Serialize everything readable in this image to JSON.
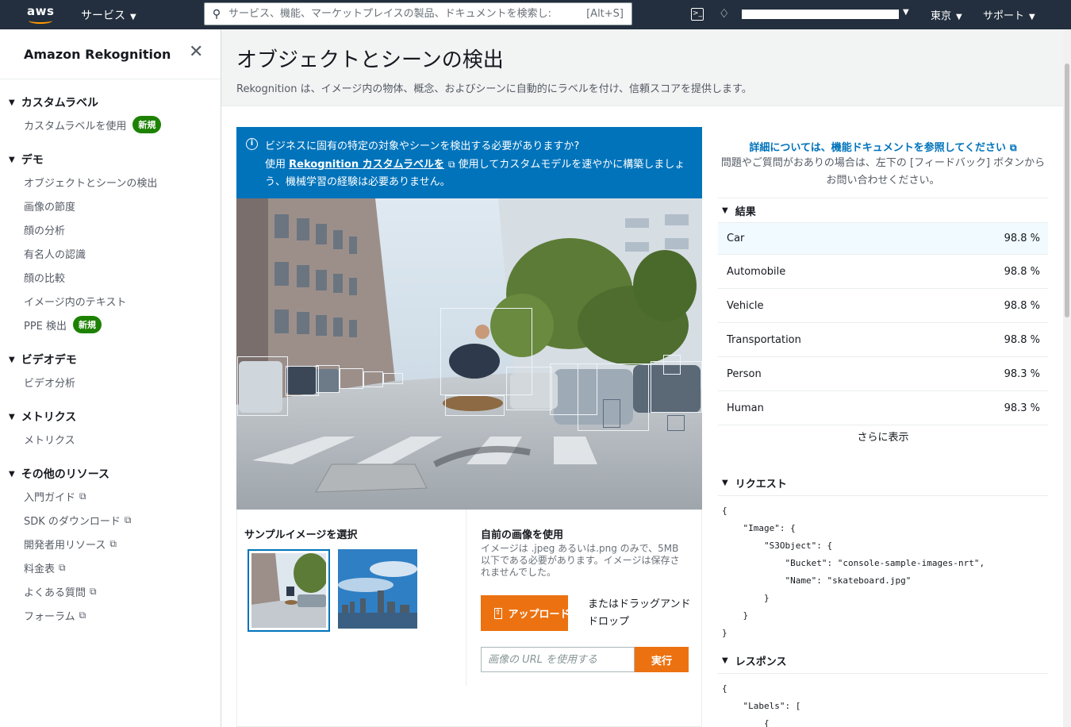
{
  "nav": {
    "logo_text": "aws",
    "services_label": "サービス",
    "search_placeholder": "サービス、機能、マーケットプレイスの製品、ドキュメントを検索し:",
    "search_shortcut": "[Alt+S]",
    "region_label": "東京",
    "support_label": "サポート"
  },
  "sidebar": {
    "title": "Amazon Rekognition",
    "sections": [
      {
        "title": "カスタムラベル",
        "items": [
          {
            "label": "カスタムラベルを使用",
            "badge": "新規"
          }
        ]
      },
      {
        "title": "デモ",
        "items": [
          {
            "label": "オブジェクトとシーンの検出"
          },
          {
            "label": "画像の節度"
          },
          {
            "label": "顔の分析"
          },
          {
            "label": "有名人の認識"
          },
          {
            "label": "顔の比較"
          },
          {
            "label": "イメージ内のテキスト"
          },
          {
            "label": "PPE 検出",
            "badge": "新規"
          }
        ]
      },
      {
        "title": "ビデオデモ",
        "items": [
          {
            "label": "ビデオ分析"
          }
        ]
      },
      {
        "title": "メトリクス",
        "items": [
          {
            "label": "メトリクス"
          }
        ]
      },
      {
        "title": "その他のリソース",
        "items": [
          {
            "label": "入門ガイド",
            "external": true
          },
          {
            "label": "SDK のダウンロード",
            "external": true
          },
          {
            "label": "開発者用リソース",
            "external": true
          },
          {
            "label": "料金表",
            "external": true
          },
          {
            "label": "よくある質問",
            "external": true
          },
          {
            "label": "フォーラム",
            "external": true
          }
        ]
      }
    ]
  },
  "page": {
    "title": "オブジェクトとシーンの検出",
    "description": "Rekognition は、イメージ内の物体、概念、およびシーンに自動的にラベルを付け、信頼スコアを提供します。"
  },
  "banner": {
    "line1": "ビジネスに固有の特定の対象やシーンを検出する必要がありますか?",
    "pre_link": "使用 ",
    "link": "Rekognition カスタムラベルを",
    "post_link": " 使用してカスタムモデルを速やかに構築しましょう、機械学習の経験は必要ありません。"
  },
  "lower": {
    "sample_title": "サンプルイメージを選択",
    "own_title": "自前の画像を使用",
    "own_desc": "イメージは .jpeg あるいは.png のみで、5MB 以下である必要があります。イメージは保存されませんでした。",
    "upload_label": "アップロード",
    "drag_text": "またはドラッグアンドドロップ",
    "url_placeholder": "画像の URL を使用する",
    "run_label": "実行"
  },
  "right": {
    "doc_link": "詳細については、機能ドキュメントを参照してください",
    "doc_help": "問題やご質問がおありの場合は、左下の [フィードバック] ボタンからお問い合わせください。",
    "results_title": "結果",
    "results": [
      {
        "label": "Car",
        "score": "98.8 %"
      },
      {
        "label": "Automobile",
        "score": "98.8 %"
      },
      {
        "label": "Vehicle",
        "score": "98.8 %"
      },
      {
        "label": "Transportation",
        "score": "98.8 %"
      },
      {
        "label": "Person",
        "score": "98.3 %"
      },
      {
        "label": "Human",
        "score": "98.3 %"
      }
    ],
    "show_more": "さらに表示",
    "request_title": "リクエスト",
    "request_code": "{\n    \"Image\": {\n        \"S3Object\": {\n            \"Bucket\": \"console-sample-images-nrt\",\n            \"Name\": \"skateboard.jpg\"\n        }\n    }\n}",
    "response_title": "レスポンス",
    "response_code": "{\n    \"Labels\": [\n        {"
  }
}
